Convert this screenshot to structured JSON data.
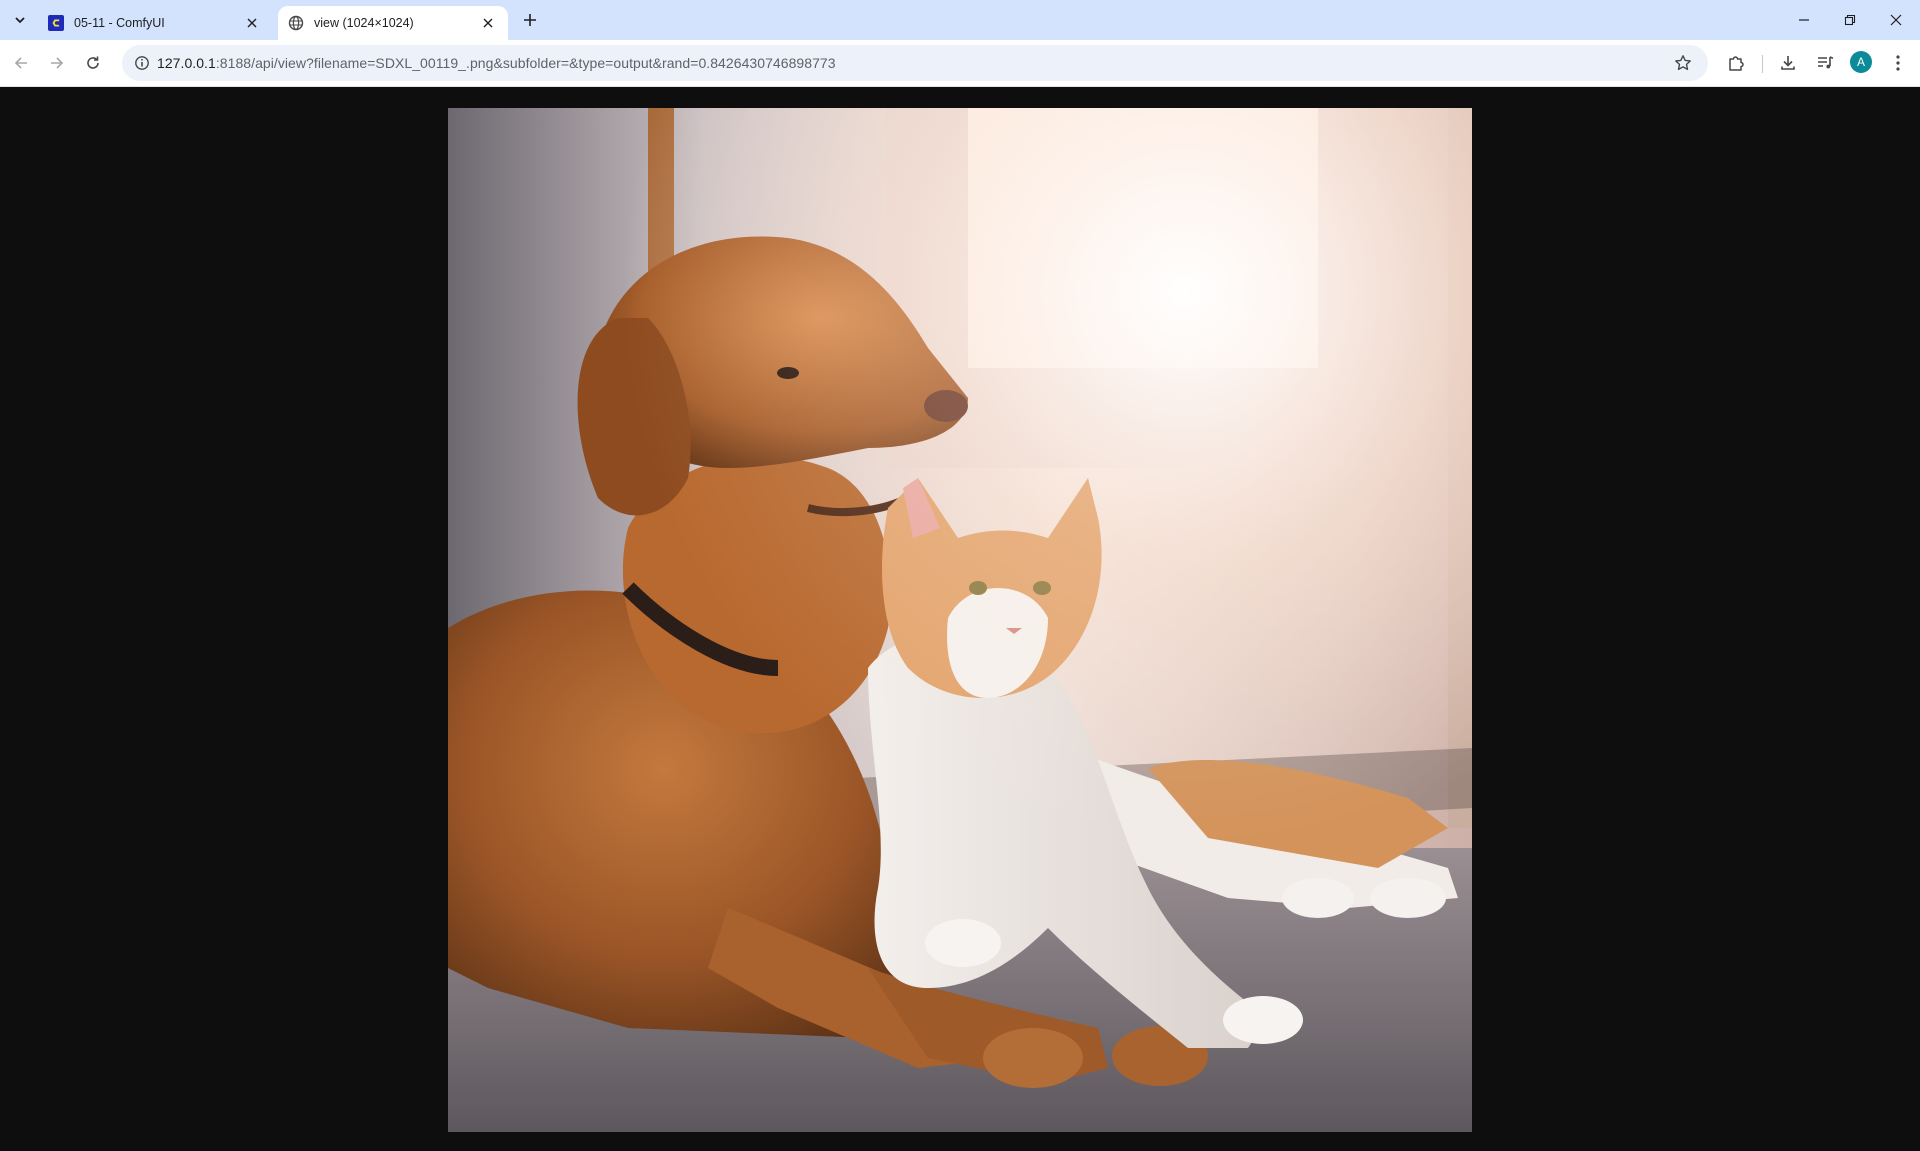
{
  "tabs": [
    {
      "title": "05-11 - ComfyUI",
      "active": false,
      "favicon": "comfyui-logo-icon"
    },
    {
      "title": "view (1024×1024)",
      "active": true,
      "favicon": "globe-icon"
    }
  ],
  "address_bar": {
    "url_host": "127.0.0.1",
    "url_rest": ":8188/api/view?filename=SDXL_00119_.png&subfolder=&type=output&rand=0.8426430746898773"
  },
  "profile": {
    "initial": "A"
  },
  "colors": {
    "tabstrip": "#d3e3fd",
    "omnibox": "#edf2fa",
    "page_background": "#0e0e0e",
    "avatar": "#0b8a97"
  },
  "image": {
    "width": 1024,
    "height": 1024
  }
}
